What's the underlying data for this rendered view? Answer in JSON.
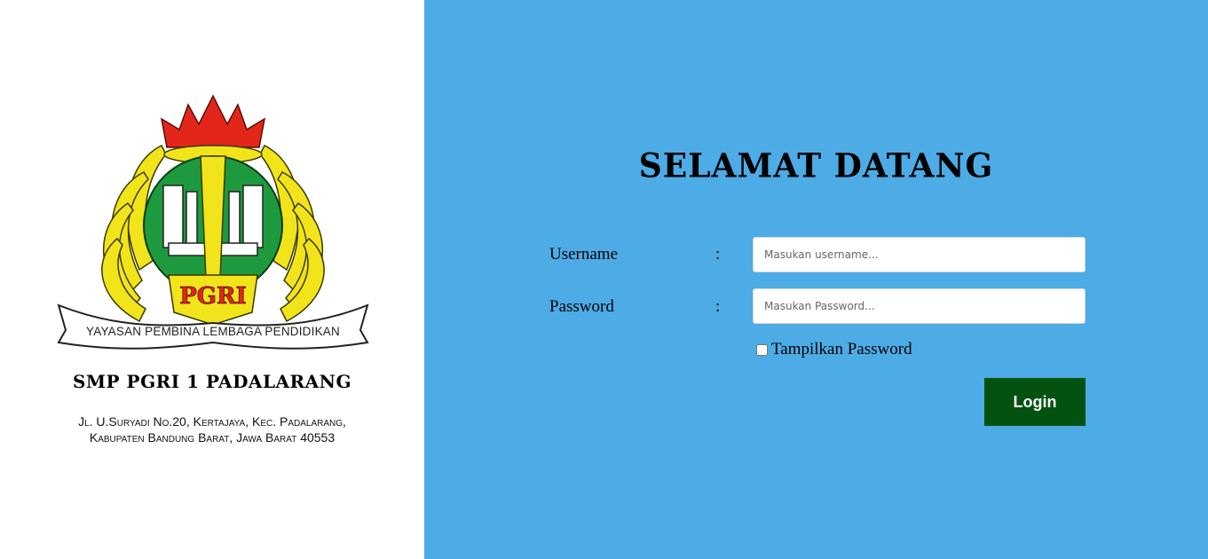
{
  "school": {
    "name": "SMP PGRI 1 PADALARANG",
    "address_line1": "Jl. U.Suryadi No.20, Kertajaya, Kec. Padalarang,",
    "address_line2": "Kabupaten Bandung Barat, Jawa Barat 40553",
    "logo": {
      "icon": "pgri-logo",
      "badge_text": "PGRI",
      "ribbon_text": "YAYASAN PEMBINA LEMBAGA PENDIDIKAN"
    }
  },
  "login": {
    "title": "SELAMAT DATANG",
    "username_label": "Username",
    "username_colon": ":",
    "username_placeholder": "Masukan username...",
    "username_value": "",
    "password_label": "Password",
    "password_colon": ":",
    "password_placeholder": "Masukan Password...",
    "password_value": "",
    "show_password_label": "Tampilkan Password",
    "show_password_checked": false,
    "submit_label": "Login"
  },
  "colors": {
    "left_background": "#ffffff",
    "right_background": "#4dabe5",
    "button_background": "#03520f",
    "button_text": "#ffffff"
  }
}
